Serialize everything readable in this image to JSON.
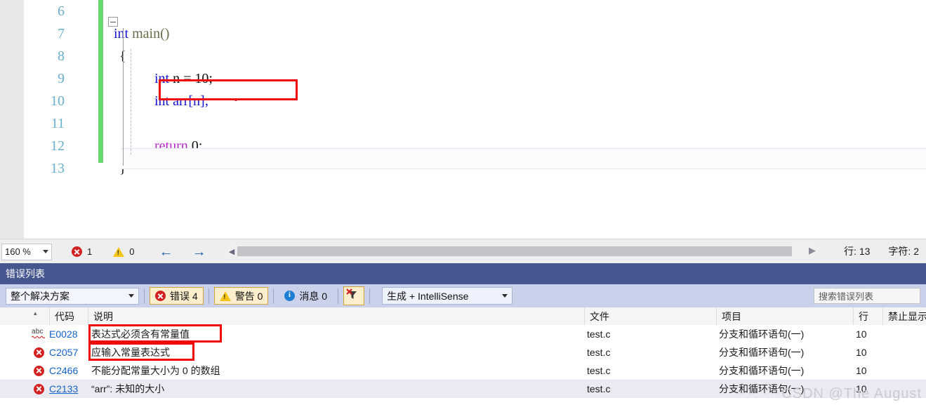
{
  "editor": {
    "line_numbers": [
      "6",
      "7",
      "8",
      "9",
      "10",
      "11",
      "12",
      "13"
    ],
    "code": {
      "l7_kw": "int",
      "l7_fn": " main()",
      "l8": "{",
      "l9_kw": "int",
      "l9_rest": " n = 10;",
      "l10_kw": "int",
      "l10_rest": " arr[n];",
      "l12_kw": "return",
      "l12_rest": " 0;",
      "l13": "}"
    }
  },
  "statusbar": {
    "zoom_level": "160 %",
    "error_count": "1",
    "warning_count": "0",
    "back_arrow": "←",
    "forward_arrow": "→",
    "scroll_left_arrow": "◀",
    "scroll_right_arrow": "▶",
    "line_label": "行: 13",
    "char_label": "字符: 2"
  },
  "panel": {
    "title": "错误列表",
    "scope_filter": "整个解决方案",
    "errors_label": "错误 4",
    "warnings_label": "警告 0",
    "messages_label": "消息 0",
    "build_filter": "生成 + IntelliSense",
    "search_placeholder": "搜索错误列表"
  },
  "grid": {
    "columns": [
      {
        "key": "icon",
        "label": ""
      },
      {
        "key": "code",
        "label": "代码"
      },
      {
        "key": "description",
        "label": "说明"
      },
      {
        "key": "file",
        "label": "文件"
      },
      {
        "key": "project",
        "label": "项目"
      },
      {
        "key": "line",
        "label": "行"
      },
      {
        "key": "suppression",
        "label": "禁止显示状态"
      }
    ],
    "rows": [
      {
        "icon": "intellisense-abc-icon",
        "code": "E0028",
        "description": "表达式必须含有常量值",
        "file": "test.c",
        "project": "分支和循环语句(一)",
        "line": "10",
        "suppression": "",
        "selected": false,
        "underlined": false
      },
      {
        "icon": "error-icon",
        "code": "C2057",
        "description": "应输入常量表达式",
        "file": "test.c",
        "project": "分支和循环语句(一)",
        "line": "10",
        "suppression": "",
        "selected": false,
        "underlined": false
      },
      {
        "icon": "error-icon",
        "code": "C2466",
        "description": "不能分配常量大小为 0 的数组",
        "file": "test.c",
        "project": "分支和循环语句(一)",
        "line": "10",
        "suppression": "",
        "selected": false,
        "underlined": false
      },
      {
        "icon": "error-icon",
        "code": "C2133",
        "description": "“arr”: 未知的大小",
        "file": "test.c",
        "project": "分支和循环语句(一)",
        "line": "10",
        "suppression": "",
        "selected": true,
        "underlined": true
      }
    ]
  },
  "watermark": {
    "text": "CSDN @The  August"
  },
  "colors": {
    "panel_title_bg": "#46578f",
    "toolbar_bg": "#c9d2ea",
    "highlight_red": "#f00a0a",
    "change_bar_green": "#68d971",
    "keyword_blue": "#1414d2",
    "return_purple": "#b428c8",
    "linenum_blue": "#68b0cf",
    "link_blue": "#1464c8"
  }
}
